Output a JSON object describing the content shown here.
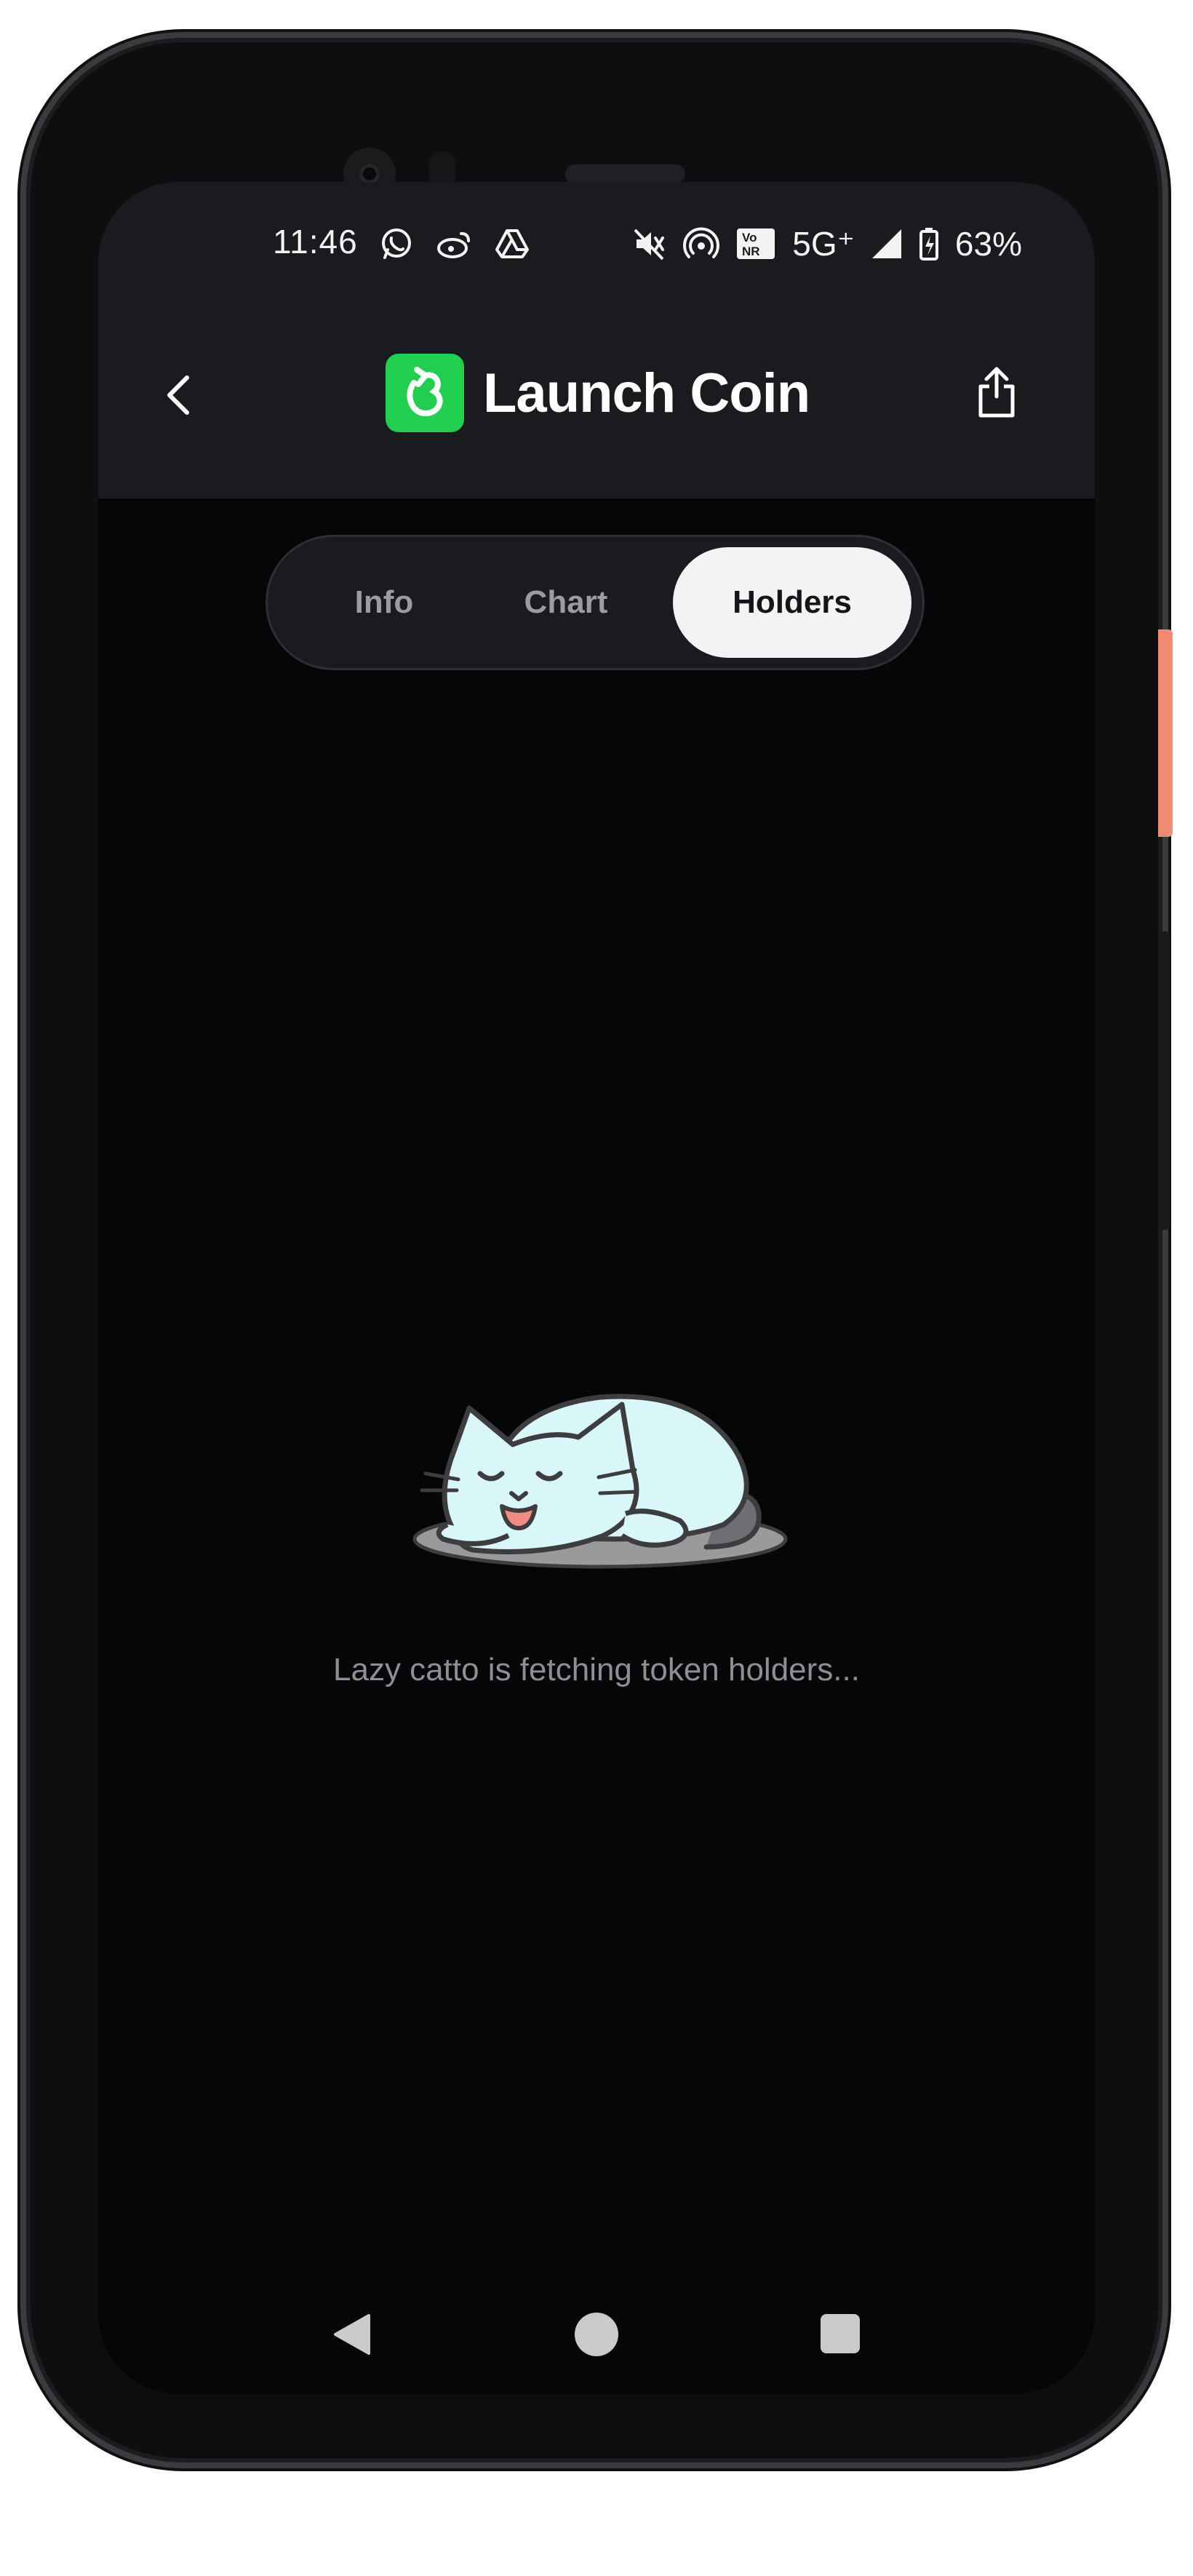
{
  "status_bar": {
    "time": "11:46",
    "network": "5G⁺",
    "vo_label": "Vo",
    "nr_label": "NR",
    "battery": "63%"
  },
  "header": {
    "title": "Launch Coin",
    "back_icon": "chevron-left-icon",
    "share_icon": "share-icon",
    "logo_color": "#1fcf4d"
  },
  "tabs": [
    {
      "label": "Info",
      "selected": false
    },
    {
      "label": "Chart",
      "selected": false
    },
    {
      "label": "Holders",
      "selected": true
    }
  ],
  "empty_state": {
    "illustration": "sleeping-cat-illustration",
    "message": "Lazy catto is fetching token holders..."
  },
  "navigation_bar": {
    "back": "nav-back-icon",
    "home": "nav-home-icon",
    "recents": "nav-recents-icon"
  }
}
